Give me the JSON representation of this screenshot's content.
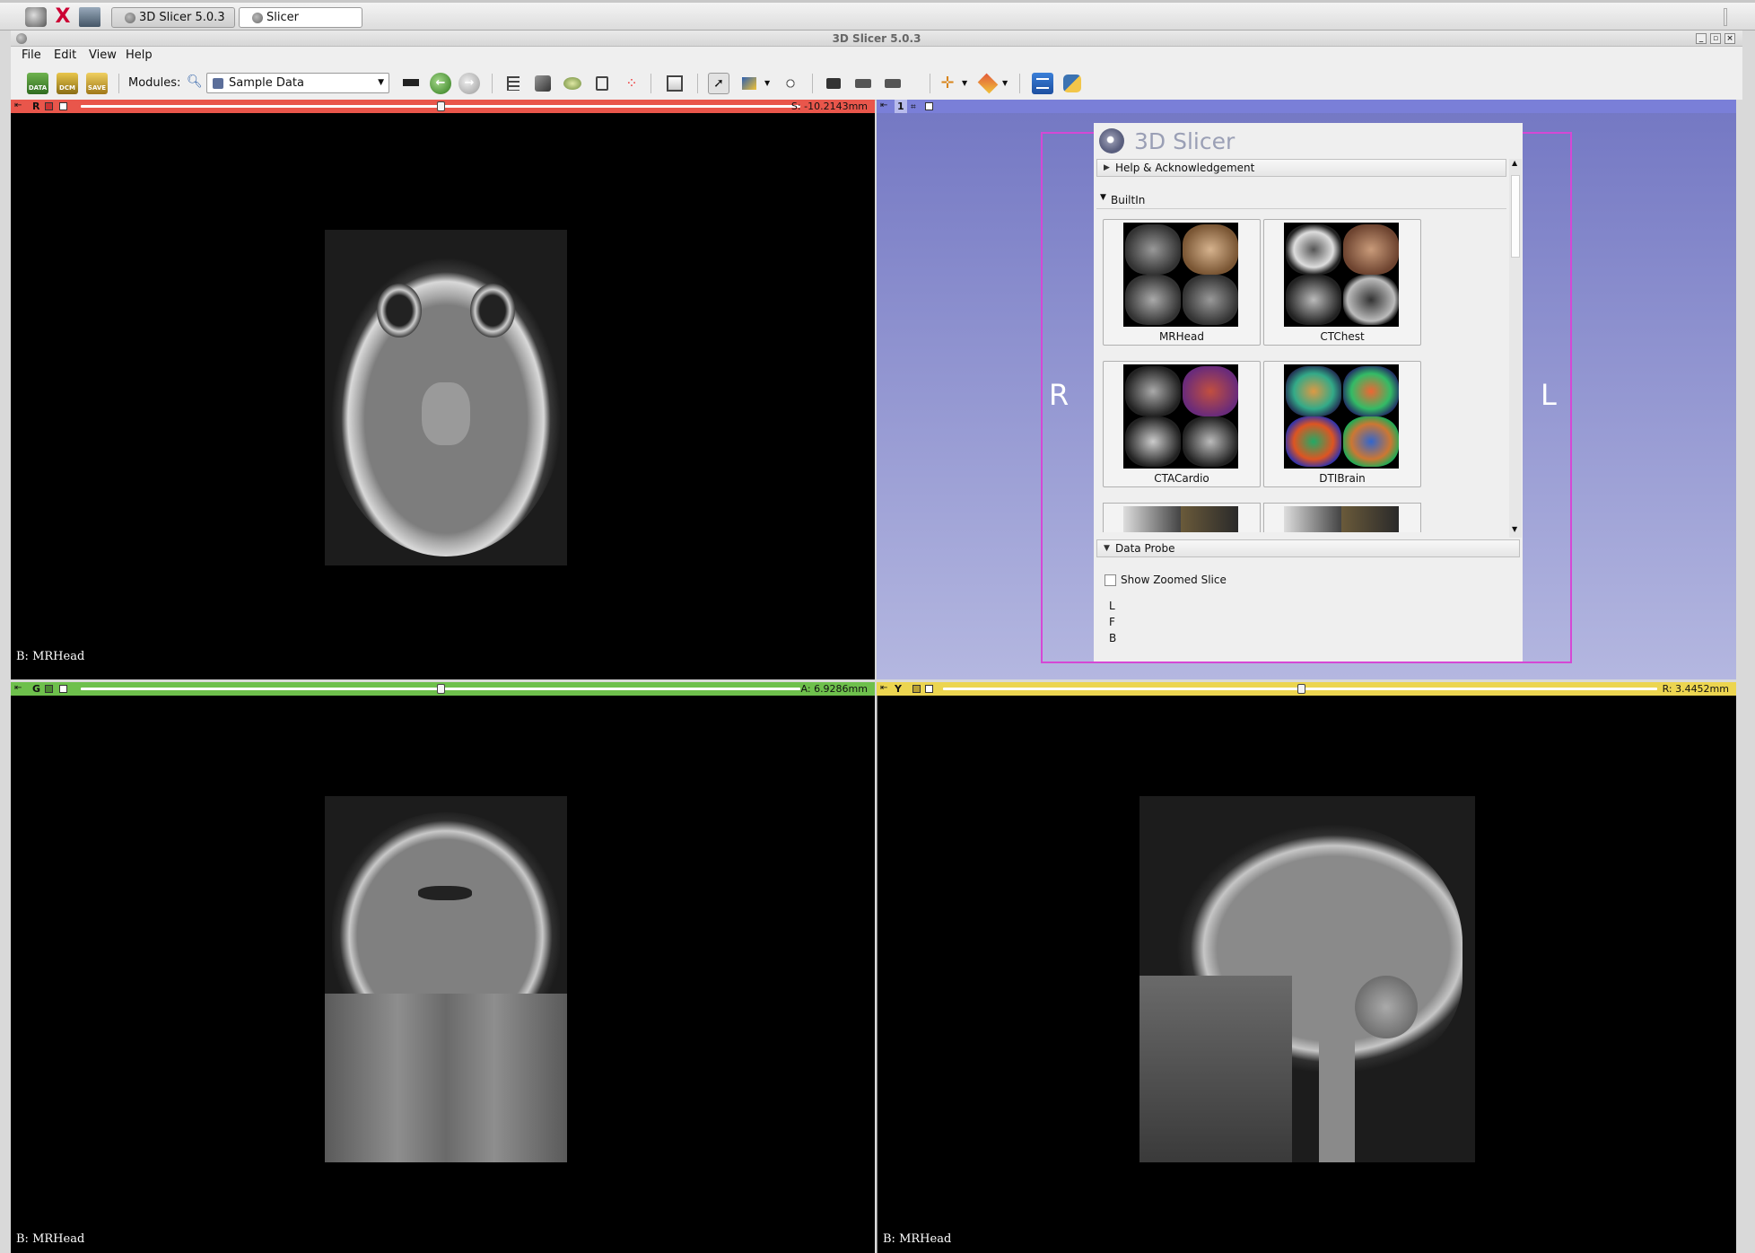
{
  "taskbar": {
    "tasks": [
      {
        "label": "3D Slicer 5.0.3"
      },
      {
        "label": "Slicer"
      }
    ]
  },
  "window": {
    "title": "3D Slicer 5.0.3"
  },
  "menu": {
    "file": "File",
    "edit": "Edit",
    "view": "View",
    "help": "Help"
  },
  "toolbar": {
    "modules_label": "Modules:",
    "module_selected": "Sample Data",
    "icons": [
      "data-icon",
      "dcm-icon",
      "save-icon",
      "back-icon",
      "forward-icon"
    ],
    "data_label": "DATA",
    "dcm_label": "DCM",
    "save_label": "SAVE"
  },
  "views": {
    "red": {
      "letter": "R",
      "offset": "S: -10.2143mm",
      "label": "B: MRHead",
      "color": "#e9564b"
    },
    "green": {
      "letter": "G",
      "offset": "A: 6.9286mm",
      "label": "B: MRHead",
      "color": "#6ec04c"
    },
    "yellow": {
      "letter": "Y",
      "offset": "R: 3.4452mm",
      "label": "B: MRHead",
      "color": "#ecd550"
    },
    "threed": {
      "letter": "1",
      "left_marker": "R",
      "right_marker": "L",
      "color": "#7a7fd8"
    }
  },
  "panel": {
    "title": "3D Slicer",
    "help_section": "Help & Acknowledgement",
    "builtin_section": "BuiltIn",
    "samples": [
      {
        "name": "MRHead"
      },
      {
        "name": "CTChest"
      },
      {
        "name": "CTACardio"
      },
      {
        "name": "DTIBrain"
      }
    ],
    "data_probe_section": "Data Probe",
    "show_zoomed_slice": "Show Zoomed Slice",
    "probe_rows": [
      "L",
      "F",
      "B"
    ]
  }
}
